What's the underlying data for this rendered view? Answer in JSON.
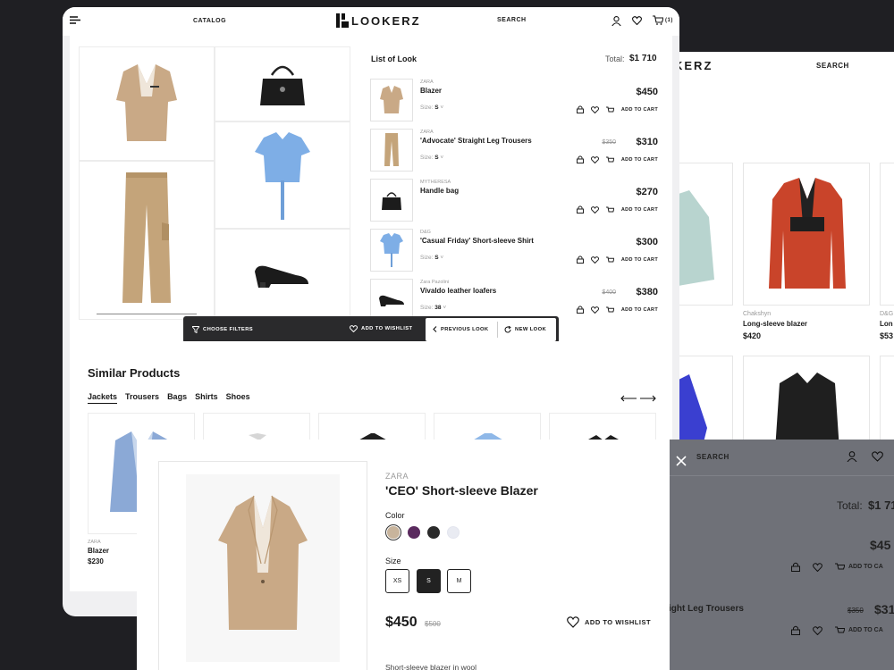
{
  "main": {
    "nav": {
      "catalog": "CATALOG",
      "brand": "LOOKERZ",
      "search": "SEARCH",
      "cart_count": "(1)"
    },
    "look": {
      "title": "List of Look",
      "total_label": "Total:",
      "total_value": "$1 710",
      "items": [
        {
          "brand": "ZARA",
          "name": "Blazer",
          "size_label": "Size:",
          "size": "S",
          "price": "$450",
          "old_price": "",
          "add_to_cart": "ADD TO CART"
        },
        {
          "brand": "ZARA",
          "name": "'Advocate' Straight Leg Trousers",
          "size_label": "Size:",
          "size": "S",
          "price": "$310",
          "old_price": "$350",
          "add_to_cart": "ADD TO CART"
        },
        {
          "brand": "MYTHERESA",
          "name": "Handle bag",
          "size_label": "",
          "size": "",
          "price": "$270",
          "old_price": "",
          "add_to_cart": "ADD TO CART"
        },
        {
          "brand": "D&G",
          "name": "'Casual Friday' Short-sleeve Shirt",
          "size_label": "Size:",
          "size": "S",
          "price": "$300",
          "old_price": "",
          "add_to_cart": "ADD TO CART"
        },
        {
          "brand": "Zara Pazolini",
          "name": "Vivaldo leather loafers",
          "size_label": "Size:",
          "size": "38",
          "price": "$380",
          "old_price": "$400",
          "add_to_cart": "ADD TO CART"
        }
      ]
    },
    "toolbar": {
      "filters": "CHOOSE FILTERS",
      "wishlist": "ADD TO WISHLIST",
      "previous": "PREVIOUS LOOK",
      "new": "NEW LOOK"
    },
    "similar": {
      "title": "Similar Products",
      "tabs": [
        "Jackets",
        "Trousers",
        "Bags",
        "Shirts",
        "Shoes"
      ],
      "active_tab": 0,
      "card": {
        "brand": "ZARA",
        "name": "Blazer",
        "price": "$230"
      }
    }
  },
  "back_window": {
    "brand_part": "KERZ",
    "search": "SEARCH",
    "products": [
      {
        "brand": "Chakshyn",
        "name": "Long-sleeve blazer",
        "price": "$420"
      },
      {
        "brand": "D&G",
        "name": "Lon",
        "price": "$53"
      }
    ]
  },
  "modal": {
    "brand": "ZARA",
    "title": "'CEO' Short-sleeve Blazer",
    "color_label": "Color",
    "colors": [
      "#c8b49c",
      "#5a2a5e",
      "#2a2a2a",
      "#e9ebf2"
    ],
    "size_label": "Size",
    "sizes": [
      "XS",
      "S",
      "M"
    ],
    "selected_size": "S",
    "price": "$450",
    "old_price": "$500",
    "wishlist": "ADD TO WISHLIST",
    "description": "Short-sleeve blazer in wool"
  },
  "modal_right": {
    "search": "SEARCH",
    "total_label": "Total:",
    "total_value": "$1 71",
    "price1": "$45",
    "cart1": "ADD TO CA",
    "item2_name": "ight Leg Trousers",
    "item2_old": "$350",
    "item2_price": "$31",
    "cart2": "ADD TO CA"
  }
}
